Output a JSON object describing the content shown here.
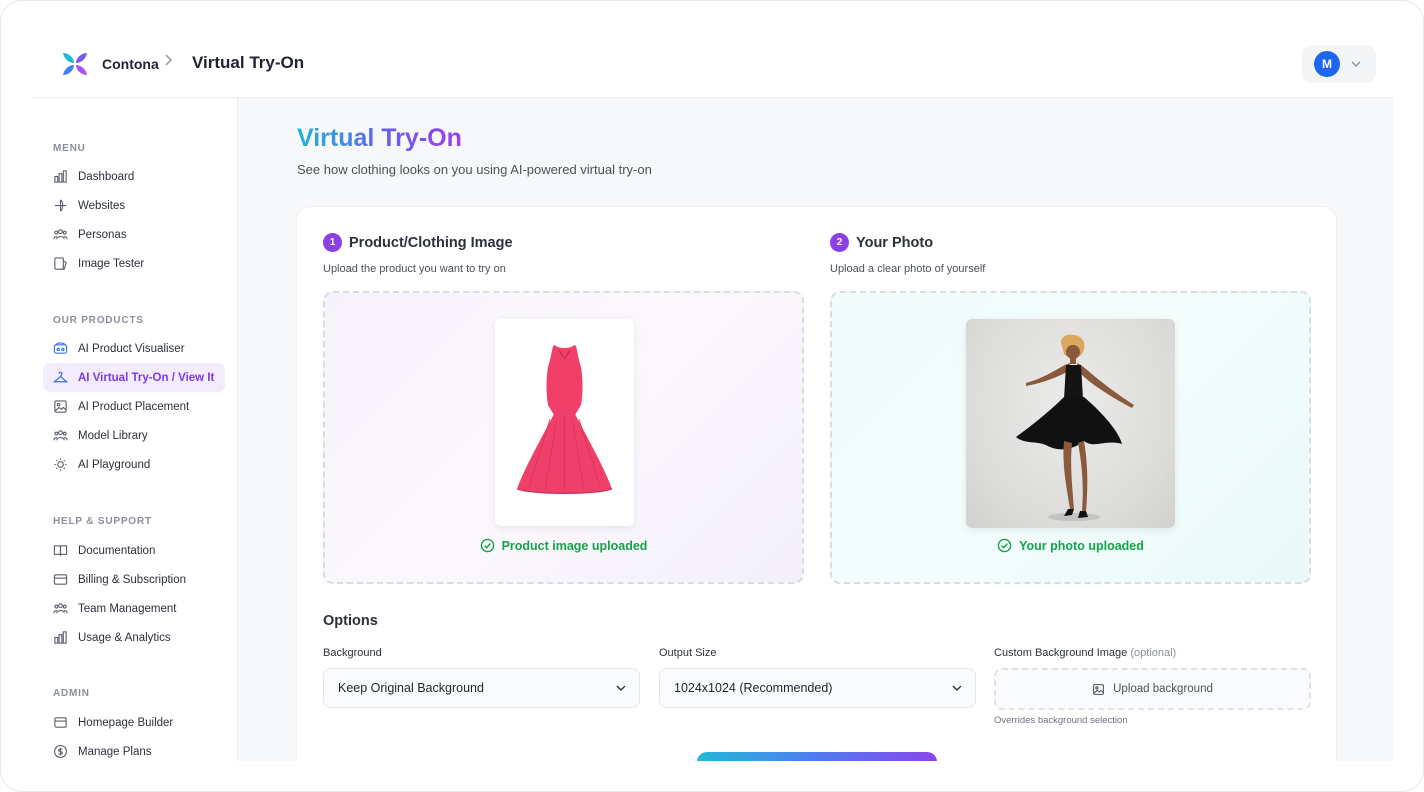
{
  "header": {
    "brand": "Contona",
    "breadcrumb_separator": ">",
    "page": "Virtual Try-On",
    "user_initial": "M"
  },
  "sidebar": {
    "sections": [
      {
        "title": "MENU",
        "items": [
          {
            "label": "Dashboard",
            "icon": "bar-chart-icon"
          },
          {
            "label": "Websites",
            "icon": "globe-icon"
          },
          {
            "label": "Personas",
            "icon": "users-icon"
          },
          {
            "label": "Image Tester",
            "icon": "image-test-icon"
          }
        ]
      },
      {
        "title": "OUR PRODUCTS",
        "items": [
          {
            "label": "AI Product Visualiser",
            "icon": "vr-icon"
          },
          {
            "label": "AI Virtual Try-On / View It",
            "icon": "hanger-icon",
            "active": true
          },
          {
            "label": "AI Product Placement",
            "icon": "image-icon"
          },
          {
            "label": "Model Library",
            "icon": "users-icon"
          },
          {
            "label": "AI Playground",
            "icon": "lightbulb-icon"
          }
        ]
      },
      {
        "title": "HELP & SUPPORT",
        "items": [
          {
            "label": "Documentation",
            "icon": "book-icon"
          },
          {
            "label": "Billing & Subscription",
            "icon": "card-icon"
          },
          {
            "label": "Team Management",
            "icon": "users-icon"
          },
          {
            "label": "Usage & Analytics",
            "icon": "bar-chart-icon"
          }
        ]
      },
      {
        "title": "ADMIN",
        "items": [
          {
            "label": "Homepage Builder",
            "icon": "layout-icon"
          },
          {
            "label": "Manage Plans",
            "icon": "dollar-icon"
          }
        ]
      }
    ]
  },
  "main": {
    "title": "Virtual Try-On",
    "subtitle": "See how clothing looks on you using AI-powered virtual try-on",
    "step1": {
      "number": "1",
      "title": "Product/Clothing Image",
      "subtitle": "Upload the product you want to try on",
      "status": "Product image uploaded"
    },
    "step2": {
      "number": "2",
      "title": "Your Photo",
      "subtitle": "Upload a clear photo of yourself",
      "status": "Your photo uploaded"
    },
    "options": {
      "title": "Options",
      "background_label": "Background",
      "background_value": "Keep Original Background",
      "output_label": "Output Size",
      "output_value": "1024x1024 (Recommended)",
      "custom_bg_label": "Custom Background Image",
      "custom_bg_optional": "(optional)",
      "upload_label": "Upload background",
      "hint": "Overrides background selection"
    }
  },
  "colors": {
    "accent_purple": "#8b3fe6",
    "success_green": "#16a34a",
    "avatar_blue": "#1c66f2",
    "dress_pink": "#f0406a"
  }
}
